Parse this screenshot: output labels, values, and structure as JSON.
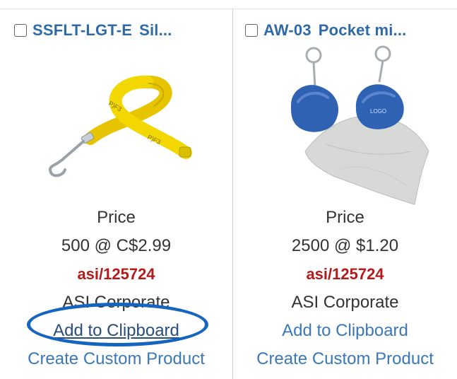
{
  "products": [
    {
      "checkbox_checked": false,
      "sku": "SSFLT-LGT-E",
      "name_truncated": "Sil...",
      "image_icon": "lanyard-image",
      "price_label": "Price",
      "price_value": "500 @ C$2.99",
      "asi_number": "asi/125724",
      "supplier": "ASI Corporate",
      "add_to_clipboard": "Add to Clipboard",
      "create_custom_product": "Create Custom Product",
      "highlighted": true
    },
    {
      "checkbox_checked": false,
      "sku": "AW-03",
      "name_truncated": "Pocket mi...",
      "image_icon": "microfiber-cloth-keychain-image",
      "price_label": "Price",
      "price_value": "2500 @ $1.20",
      "asi_number": "asi/125724",
      "supplier": "ASI Corporate",
      "add_to_clipboard": "Add to Clipboard",
      "create_custom_product": "Create Custom Product",
      "highlighted": false
    }
  ],
  "colors": {
    "title_link": "#2f6aa6",
    "asi_red": "#b31b1b",
    "link_blue": "#3a78b8",
    "highlight_blue": "#1565c0"
  }
}
